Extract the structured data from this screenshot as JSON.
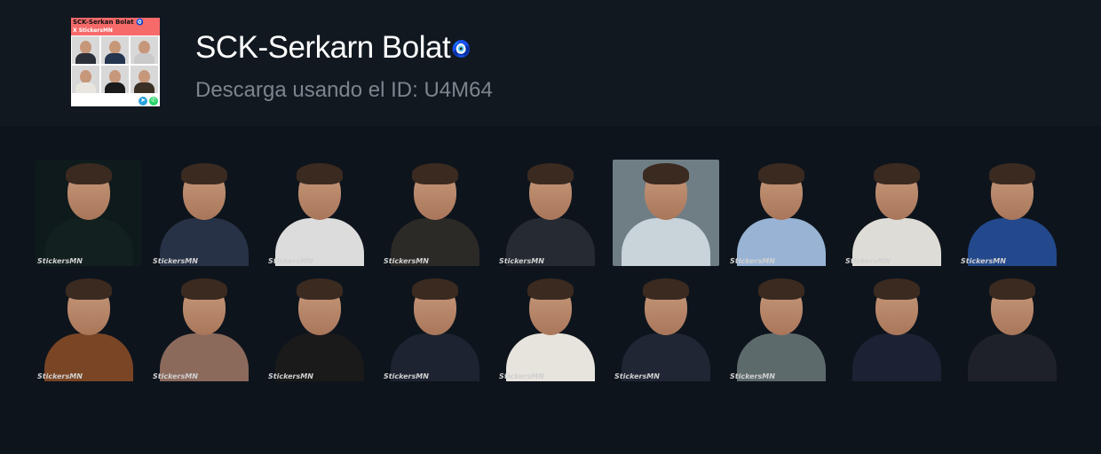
{
  "pack": {
    "title": "SCK-Serkarn Bolat",
    "title_emoji": "🧿",
    "subtitle": "Descarga usando el ID: U4M64",
    "thumbnail": {
      "line1": "SCK-Serkan Bolat 🧿",
      "line2": "X StickersMN",
      "icons": [
        "telegram-icon",
        "whatsapp-icon"
      ]
    }
  },
  "stickers": [
    {
      "watermark": "StickersMN",
      "bg": "#0e1a1c",
      "body": "#12201f"
    },
    {
      "watermark": "StickersMN",
      "bg": "#0e141c",
      "body": "#273247"
    },
    {
      "watermark": "StickersMN",
      "bg": "#0e141c",
      "body": "#dcdcdc"
    },
    {
      "watermark": "StickersMN",
      "bg": "#0e141c",
      "body": "#2b2a26"
    },
    {
      "watermark": "StickersMN",
      "bg": "#0e141c",
      "body": "#252a33"
    },
    {
      "watermark": "",
      "bg": "#6f7e85",
      "body": "#c9d3da"
    },
    {
      "watermark": "StickersMN",
      "bg": "#0e141c",
      "body": "#98b3d4"
    },
    {
      "watermark": "StickersMN",
      "bg": "#0e141c",
      "body": "#dedcd6"
    },
    {
      "watermark": "StickersMN",
      "bg": "#0e141c",
      "body": "#23498c"
    },
    {
      "watermark": "StickersMN",
      "bg": "#0e141c",
      "body": "#7a4525"
    },
    {
      "watermark": "StickersMN",
      "bg": "#0e141c",
      "body": "#8b6a5c"
    },
    {
      "watermark": "StickersMN",
      "bg": "#0e141c",
      "body": "#1a1a1a"
    },
    {
      "watermark": "StickersMN",
      "bg": "#0e141c",
      "body": "#1d2330"
    },
    {
      "watermark": "StickersMN",
      "bg": "#0e141c",
      "body": "#e6e4dc"
    },
    {
      "watermark": "StickersMN",
      "bg": "#0e141c",
      "body": "#202634"
    },
    {
      "watermark": "StickersMN",
      "bg": "#0e141c",
      "body": "#5d6a6c"
    },
    {
      "watermark": "",
      "bg": "#0e141c",
      "body": "#1c2233"
    },
    {
      "watermark": "",
      "bg": "#0e141c",
      "body": "#1e2228"
    }
  ]
}
